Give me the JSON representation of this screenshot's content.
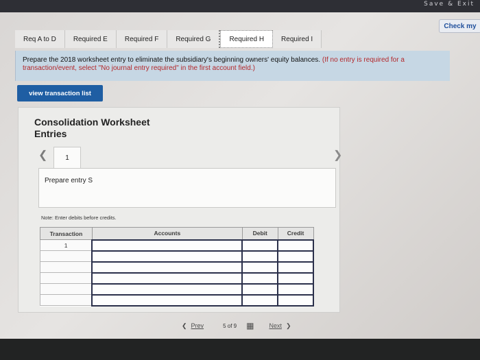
{
  "topbar": {
    "label": "Save & Exit"
  },
  "header": {
    "check_label": "Check my"
  },
  "tabs": [
    {
      "label": "Req A to D"
    },
    {
      "label": "Required E"
    },
    {
      "label": "Required F"
    },
    {
      "label": "Required G"
    },
    {
      "label": "Required H"
    },
    {
      "label": "Required I"
    }
  ],
  "instructions": {
    "text": "Prepare the 2018 worksheet entry to eliminate the subsidiary's beginning owners' equity balances.",
    "note": "(If no entry is required for a transaction/event, select \"No journal entry required\" in the first account field.)"
  },
  "buttons": {
    "view_transaction_list": "view transaction list"
  },
  "panel": {
    "title": "Consolidation Worksheet Entries",
    "entry_tab": "1",
    "entry_prompt": "Prepare entry S",
    "note": "Note: Enter debits before credits."
  },
  "journal": {
    "headers": [
      "Transaction",
      "Accounts",
      "Debit",
      "Credit"
    ],
    "rows": [
      {
        "transaction": "1",
        "account": "",
        "debit": "",
        "credit": ""
      },
      {
        "transaction": "",
        "account": "",
        "debit": "",
        "credit": ""
      },
      {
        "transaction": "",
        "account": "",
        "debit": "",
        "credit": ""
      },
      {
        "transaction": "",
        "account": "",
        "debit": "",
        "credit": ""
      },
      {
        "transaction": "",
        "account": "",
        "debit": "",
        "credit": ""
      },
      {
        "transaction": "",
        "account": "",
        "debit": "",
        "credit": ""
      }
    ]
  },
  "footer": {
    "prev_label": "Prev",
    "page_current": "5",
    "page_of": "of",
    "page_total": "9",
    "next_label": "Next"
  }
}
